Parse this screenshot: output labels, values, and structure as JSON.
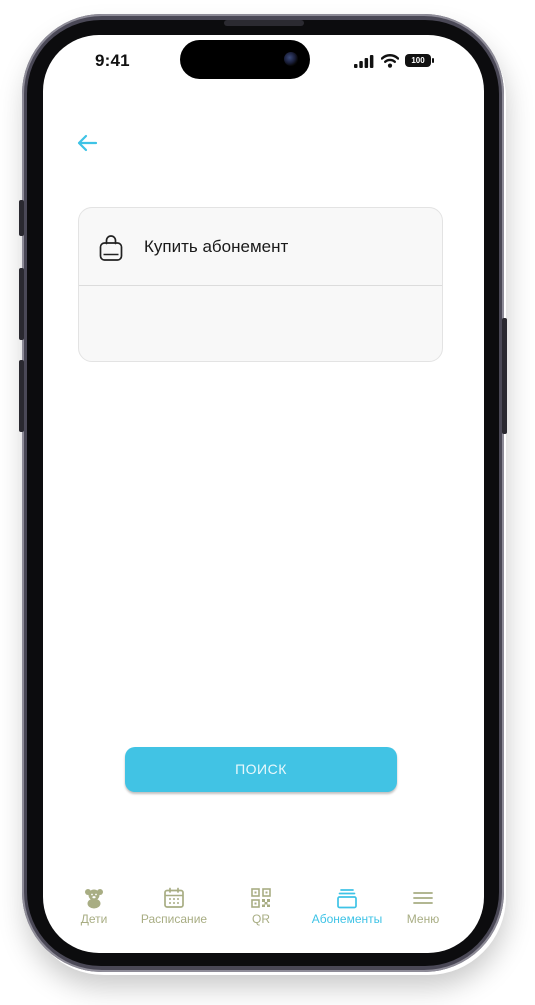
{
  "status_bar": {
    "time": "9:41",
    "battery": "100"
  },
  "card": {
    "buy_label": "Купить абонемент"
  },
  "search_button": {
    "label": "ПОИСК"
  },
  "tabs": [
    {
      "label": "Дети",
      "icon": "teddy-bear-icon",
      "active": false
    },
    {
      "label": "Расписание",
      "icon": "calendar-icon",
      "active": false
    },
    {
      "label": "QR",
      "icon": "qr-code-icon",
      "active": false
    },
    {
      "label": "Абонементы",
      "icon": "cards-stack-icon",
      "active": true
    },
    {
      "label": "Меню",
      "icon": "menu-icon",
      "active": false
    }
  ],
  "colors": {
    "accent": "#41c3e4",
    "inactive_tab": "#a8ad83",
    "active_tab": "#3ec3e6"
  }
}
